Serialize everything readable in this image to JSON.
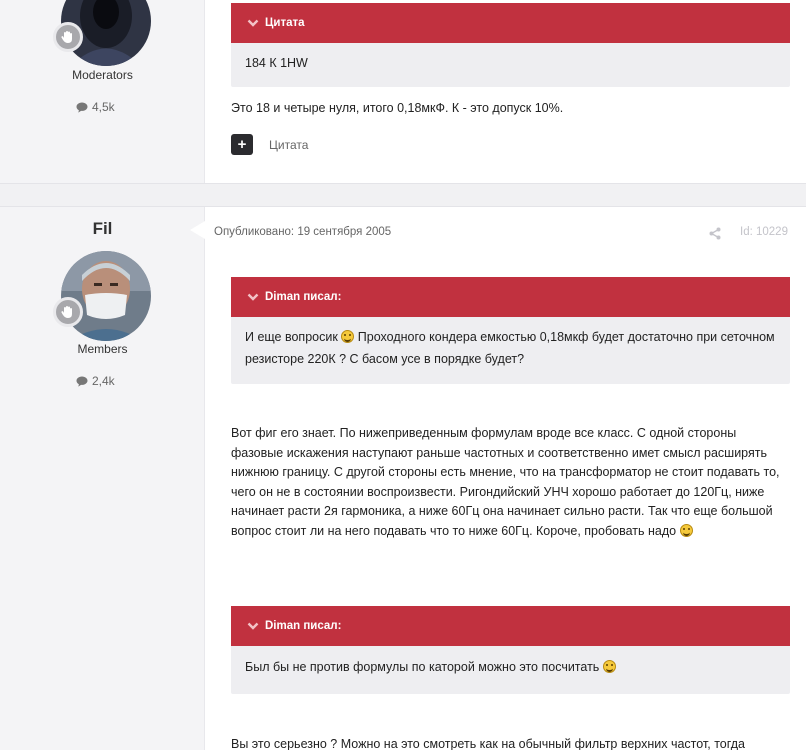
{
  "post1": {
    "author_group": "Moderators",
    "author_posts": "4,5k",
    "quote": {
      "header": "Цитата",
      "body": "184 К 1HW"
    },
    "text": "Это 18 и четыре нуля, итого 0,18мкФ. К - это допуск 10%.",
    "quote_button_label": "Цитата"
  },
  "post2": {
    "author_name": "Fil",
    "author_group": "Members",
    "author_posts": "2,4k",
    "published": "Опубликовано: 19 сентября 2005",
    "post_id": "Id: 10229",
    "quote1": {
      "header": "Diman писал:",
      "body_a": "И еще вопросик",
      "body_b": "Проходного кондера емкостью 0,18мкф будет достаточно при сеточном резисторе 220К ? С басом усе в порядке будет?"
    },
    "text1_a": "Вот фиг его знает. По нижеприведенным формулам вроде все класс. С одной стороны фазовые искажения наступают раньше частотных и соответственно имет смысл расширять нижнюю границу. С другой стороны есть мнение, что на трансформатор не стоит подавать то, чего он не в состоянии воспроизвести. Ригондийский УНЧ хорошо работает до 120Гц, ниже начинает расти 2я гармоника, а ниже 60Гц она начинает сильно расти. Так что еще большой вопрос стоит ли на него подавать что то ниже 60Гц. Короче, пробовать надо",
    "quote2": {
      "header": "Diman писал:",
      "body": "Был бы не против формулы по каторой можно это посчитать"
    },
    "text2": "Вы это серьезно ? Можно на это смотреть как на обычный фильтр верхних частот, тогда"
  },
  "colors": {
    "quote_header": "#c1313f",
    "quote_body": "#eeeef1",
    "author_panel": "#f4f4f6"
  },
  "icons": {
    "badge": "hand-icon",
    "posts": "comment-icon",
    "quote_toggle": "chevron-down-icon",
    "share": "share-icon",
    "add": "plus-icon"
  }
}
